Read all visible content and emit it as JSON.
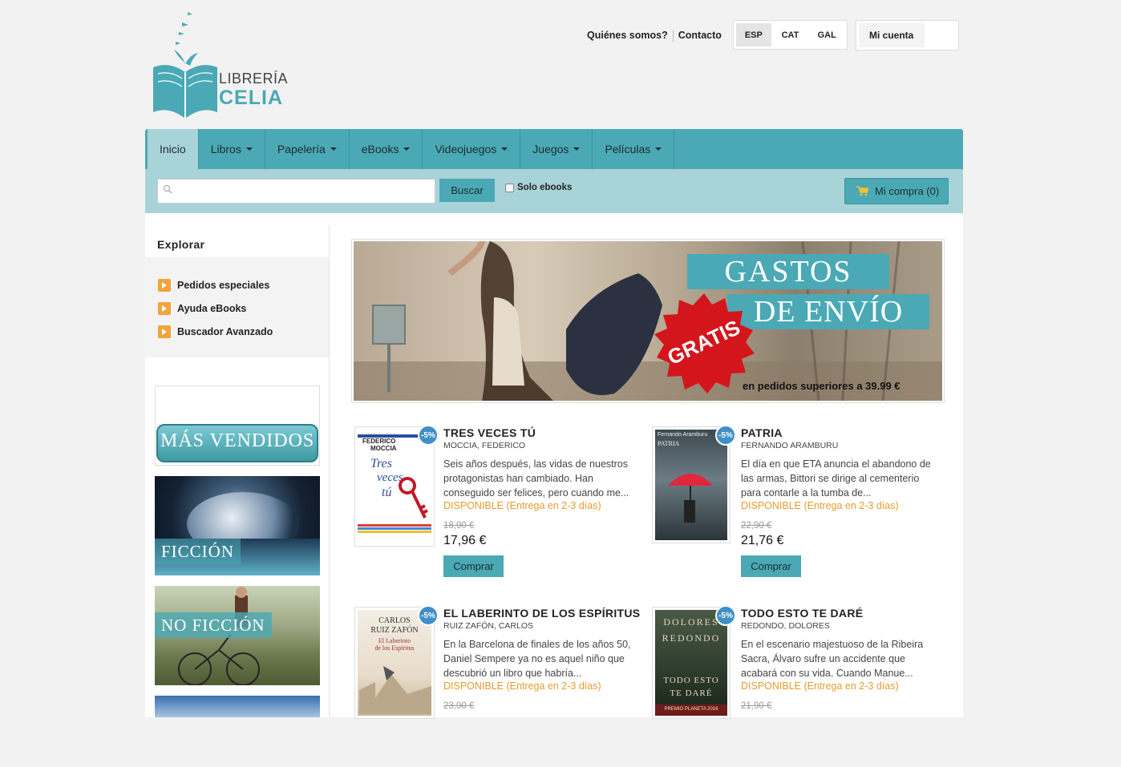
{
  "header": {
    "logo": {
      "line1": "LIBRERÍA",
      "line2": "CELIA"
    },
    "links": [
      "Quiénes somos?",
      "Contacto"
    ],
    "languages": [
      {
        "code": "ESP",
        "active": true
      },
      {
        "code": "CAT",
        "active": false
      },
      {
        "code": "GAL",
        "active": false
      }
    ],
    "account_label": "Mi cuenta"
  },
  "nav": {
    "items": [
      {
        "label": "Inicio",
        "dropdown": false,
        "active": true
      },
      {
        "label": "Libros",
        "dropdown": true
      },
      {
        "label": "Papelería",
        "dropdown": true
      },
      {
        "label": "eBooks",
        "dropdown": true
      },
      {
        "label": "Videojuegos",
        "dropdown": true
      },
      {
        "label": "Juegos",
        "dropdown": true
      },
      {
        "label": "Películas",
        "dropdown": true
      }
    ]
  },
  "search": {
    "value": "",
    "button_label": "Buscar",
    "solo_ebooks_label": "Solo ebooks",
    "solo_ebooks_checked": false,
    "cart_label": "Mi compra (0)"
  },
  "sidebar": {
    "heading": "Explorar",
    "links": [
      "Pedidos especiales",
      "Ayuda eBooks",
      "Buscador Avanzado"
    ],
    "banners": [
      "MÁS VENDIDOS",
      "FICCIÓN",
      "NO FICCIÓN"
    ]
  },
  "hero": {
    "line1": "GASTOS",
    "line2": "DE ENVÍO",
    "stamp": "GRATIS",
    "footer": "en pedidos superiores a 39.99 €"
  },
  "products": [
    {
      "badge": "-5%",
      "title": "TRES VECES TÚ",
      "author": "MOCCIA, FEDERICO",
      "desc": "Seis años después, las vidas de nuestros protagonistas han cambiado. Han conseguido ser felices, pero cuando me...",
      "availability": "DISPONIBLE (Entrega en 2-3 días)",
      "old_price": "18,90 €",
      "price": "17,96 €",
      "buy_label": "Comprar",
      "cover_text": [
        "FEDERICO",
        "MOCCIA",
        "Tres",
        "veces",
        "tú"
      ]
    },
    {
      "badge": "-5%",
      "title": "PATRIA",
      "author": "FERNANDO ARAMBURU",
      "desc": "El día en que ETA anuncia el abandono de las armas, Bittori se dirige al cementerio para contarle a la tumba de...",
      "availability": "DISPONIBLE (Entrega en 2-3 días)",
      "old_price": "22,90 €",
      "price": "21,76 €",
      "buy_label": "Comprar",
      "cover_text": [
        "Fernando Aramburu",
        "PATRIA"
      ]
    },
    {
      "badge": "-5%",
      "title": "EL LABERINTO DE LOS ESPÍRITUS",
      "author": "RUIZ ZAFÓN, CARLOS",
      "desc": "En la Barcelona de finales de los años 50, Daniel Sempere ya no es aquel niño que descubrió un libro que habría...",
      "availability": "DISPONIBLE (Entrega en 2-3 días)",
      "old_price": "23,90 €",
      "price": "",
      "buy_label": "",
      "cover_text": [
        "CARLOS",
        "RUIZ ZAFÓN",
        "El Laberinto",
        "de los Espíritus"
      ]
    },
    {
      "badge": "-5%",
      "title": "TODO ESTO TE DARÉ",
      "author": "REDONDO, DOLORES",
      "desc": "En el escenario majestuoso de la Ribeira Sacra, Álvaro sufre un accidente que acabará con su vida. Cuando Manue...",
      "availability": "DISPONIBLE (Entrega en 2-3 días)",
      "old_price": "21,90 €",
      "price": "",
      "buy_label": "",
      "cover_text": [
        "DOLORES",
        "REDONDO",
        "TODO ESTO",
        "TE DARÉ",
        "PREMIO PLANETA 2016"
      ]
    }
  ],
  "colors": {
    "primary": "#4aa9b5",
    "light": "#a8d3d8",
    "accent": "#e89b2e",
    "badge": "#3f8fc8",
    "stamp": "#d4161c"
  }
}
